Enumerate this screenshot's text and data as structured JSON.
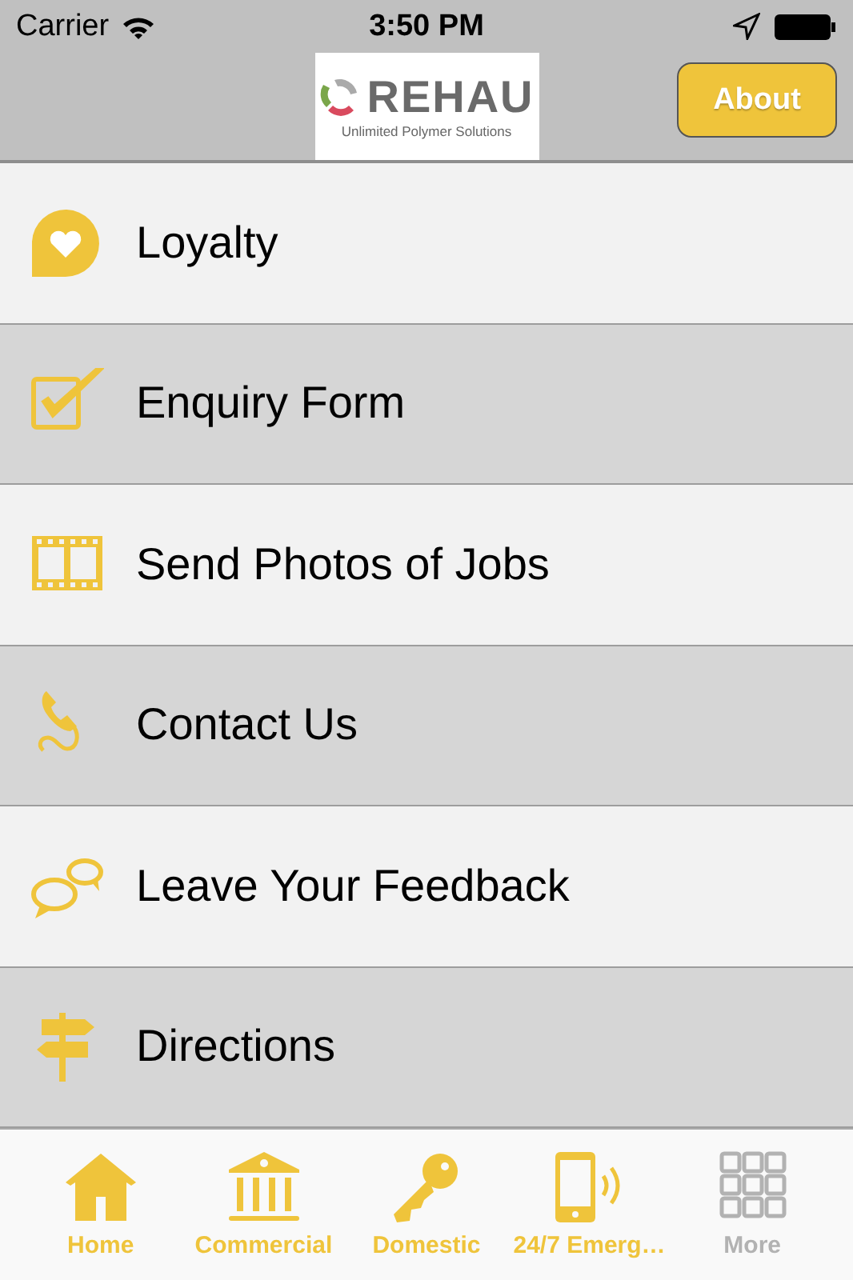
{
  "status_bar": {
    "carrier": "Carrier",
    "time": "3:50 PM"
  },
  "nav_bar": {
    "logo": {
      "name": "REHAU",
      "tagline": "Unlimited Polymer Solutions"
    },
    "button": "About"
  },
  "menu": [
    {
      "label": "Loyalty"
    },
    {
      "label": "Enquiry Form"
    },
    {
      "label": "Send Photos of Jobs"
    },
    {
      "label": "Contact Us"
    },
    {
      "label": "Leave Your Feedback"
    },
    {
      "label": "Directions"
    }
  ],
  "tab_bar": [
    {
      "label": "Home",
      "kind": "tab"
    },
    {
      "label": "Commercial",
      "kind": "tab"
    },
    {
      "label": "Domestic",
      "kind": "tab"
    },
    {
      "label": "24/7 Emerg…",
      "kind": "tab"
    },
    {
      "label": "More",
      "kind": "more"
    }
  ]
}
